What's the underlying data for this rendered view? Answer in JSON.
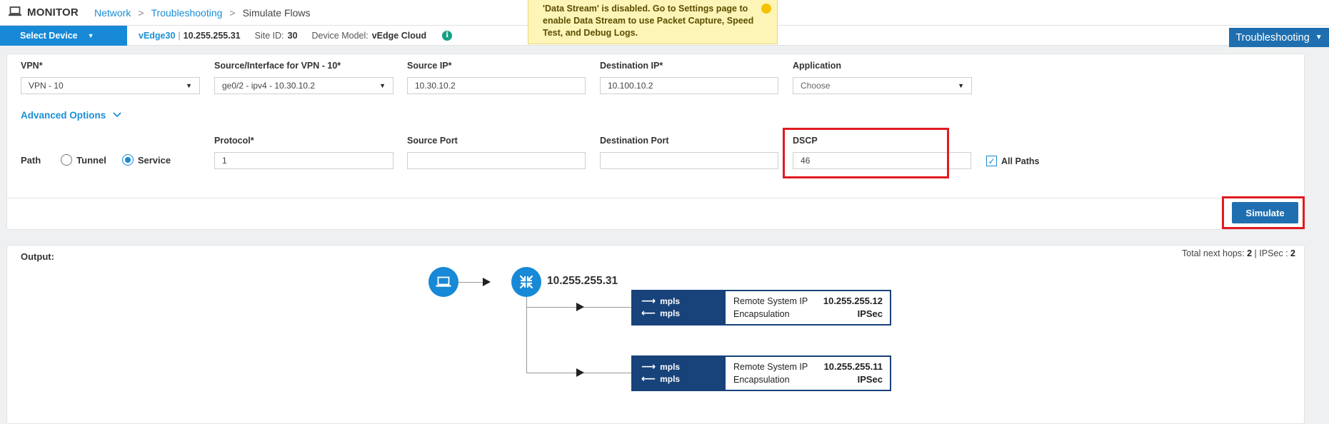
{
  "header": {
    "title": "MONITOR",
    "breadcrumb": [
      {
        "label": "Network"
      },
      {
        "label": "Troubleshooting"
      },
      {
        "label": "Simulate Flows"
      }
    ],
    "breadcrumb_separator": ">"
  },
  "notice": {
    "text": "'Data Stream' is disabled. Go to Settings page to enable Data Stream to use Packet Capture, Speed Test, and Debug Logs."
  },
  "device_bar": {
    "select_label": "Select Device",
    "device_name": "vEdge30",
    "device_ip": "10.255.255.31",
    "site_id_label": "Site ID:",
    "site_id": "30",
    "model_label": "Device Model:",
    "model": "vEdge Cloud",
    "troubleshooting_label": "Troubleshooting"
  },
  "form": {
    "vpn": {
      "label": "VPN*",
      "value": "VPN - 10"
    },
    "source_interface": {
      "label": "Source/Interface for VPN - 10*",
      "value": "ge0/2 - ipv4 - 10.30.10.2"
    },
    "source_ip": {
      "label": "Source IP*",
      "value": "10.30.10.2"
    },
    "destination_ip": {
      "label": "Destination IP*",
      "value": "10.100.10.2"
    },
    "application": {
      "label": "Application",
      "value": "Choose"
    },
    "advanced_options_label": "Advanced Options",
    "path": {
      "label": "Path",
      "options": [
        "Tunnel",
        "Service"
      ],
      "selected": "Service"
    },
    "protocol": {
      "label": "Protocol*",
      "value": "1"
    },
    "source_port": {
      "label": "Source Port",
      "value": ""
    },
    "destination_port": {
      "label": "Destination Port",
      "value": ""
    },
    "dscp": {
      "label": "DSCP",
      "value": "46"
    },
    "all_paths": {
      "label": "All Paths",
      "checked": true
    },
    "simulate_label": "Simulate"
  },
  "output": {
    "label": "Output:",
    "total_next_hops_label": "Total next hops:",
    "total_next_hops": "2",
    "ipsec_label": "IPSec :",
    "ipsec": "2",
    "source_node_ip": "10.255.255.31",
    "paths": [
      {
        "out_color": "mpls",
        "in_color": "mpls",
        "remote_label": "Remote System IP",
        "remote_ip": "10.255.255.12",
        "encap_label": "Encapsulation",
        "encap": "IPSec"
      },
      {
        "out_color": "mpls",
        "in_color": "mpls",
        "remote_label": "Remote System IP",
        "remote_ip": "10.255.255.11",
        "encap_label": "Encapsulation",
        "encap": "IPSec"
      }
    ]
  },
  "colors": {
    "accent_blue": "#1789d6",
    "dark_blue": "#1f6fb0",
    "navy": "#17427a",
    "highlight_red": "#e01b22",
    "notice_bg": "#fdf5b8"
  },
  "icons": [
    "laptop-icon",
    "router-icon",
    "info-icon",
    "chevron-down-icon",
    "caret-down-icon",
    "arrow-right-icon",
    "arrow-left-icon",
    "checkmark-icon"
  ]
}
